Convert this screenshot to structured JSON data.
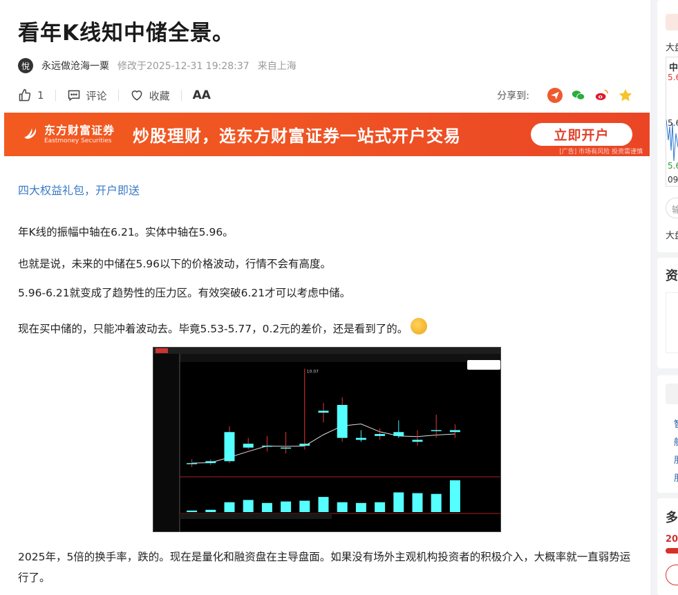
{
  "article": {
    "title": "看年K线知中储全景。",
    "author": "永远做沧海一粟",
    "avatar_text": "悅",
    "modified": "修改于2025-12-31 19:28:37",
    "location": "来自上海"
  },
  "actions": {
    "like_count": "1",
    "comment_label": "评论",
    "collect_label": "收藏",
    "font_label": "AA",
    "share_label": "分享到:"
  },
  "banner": {
    "brand_cn": "东方财富证券",
    "brand_en": "Eastmoney Securities",
    "slogan": "炒股理财，选东方财富证券一站式开户交易",
    "button": "立即开户",
    "ad_note": "[广告] 市场有风险 投资需谨慎"
  },
  "content": {
    "link": "四大权益礼包，开户即送",
    "p1": "年K线的振幅中轴在6.21。实体中轴在5.96。",
    "p2": "也就是说，未来的中储在5.96以下的价格波动，行情不会有高度。",
    "p3": "5.96-6.21就变成了趋势性的压力区。有效突破6.21才可以考虑中储。",
    "p4": "现在买中储的，只能冲着波动去。毕竟5.53-5.77，0.2元的差价，还是看到了的。",
    "p5": "2025年，5倍的换手率，跌的。现在是量化和融资盘在主导盘面。如果没有场外主观机构投资者的积极介入，大概率就一直弱势运行了。"
  },
  "sidebar": {
    "label1": "大盘",
    "stock_short": "中",
    "price_top": "5.6",
    "price_mid": "5.6",
    "price_low": "5.6",
    "time": "09",
    "input_hint": "输",
    "label2": "大盘",
    "section_title": "资",
    "item_a": "智",
    "item_b": "航",
    "item_c": "朋",
    "item_d": "朋",
    "section_title2": "多",
    "num": "20."
  },
  "chart_data": {
    "type": "candlestick",
    "title": "",
    "candles": [
      {
        "o": 5.2,
        "c": 5.2,
        "h": 5.4,
        "l": 5.0
      },
      {
        "o": 5.2,
        "c": 5.3,
        "h": 5.4,
        "l": 5.1
      },
      {
        "o": 5.3,
        "c": 6.8,
        "h": 7.1,
        "l": 5.2
      },
      {
        "o": 6.0,
        "c": 6.2,
        "h": 6.5,
        "l": 5.9
      },
      {
        "o": 6.1,
        "c": 6.1,
        "h": 6.6,
        "l": 5.8
      },
      {
        "o": 6.0,
        "c": 6.0,
        "h": 6.8,
        "l": 5.7
      },
      {
        "o": 6.1,
        "c": 6.2,
        "h": 10.07,
        "l": 5.9
      },
      {
        "o": 7.8,
        "c": 7.9,
        "h": 8.3,
        "l": 7.3
      },
      {
        "o": 6.5,
        "c": 8.2,
        "h": 8.6,
        "l": 6.3
      },
      {
        "o": 6.5,
        "c": 6.4,
        "h": 6.9,
        "l": 6.3
      },
      {
        "o": 6.6,
        "c": 6.7,
        "h": 7.0,
        "l": 6.4
      },
      {
        "o": 6.8,
        "c": 6.6,
        "h": 7.4,
        "l": 6.5
      },
      {
        "o": 6.3,
        "c": 6.4,
        "h": 6.9,
        "l": 6.1
      },
      {
        "o": 6.9,
        "c": 6.9,
        "h": 7.7,
        "l": 6.5
      },
      {
        "o": 6.8,
        "c": 6.9,
        "h": 7.2,
        "l": 6.5
      }
    ],
    "volumes": [
      0.2,
      0.3,
      1.3,
      1.6,
      1.2,
      1.4,
      1.5,
      2.0,
      1.3,
      1.2,
      1.3,
      2.6,
      2.5,
      2.4,
      4.2
    ],
    "peak_label": "10.07"
  }
}
